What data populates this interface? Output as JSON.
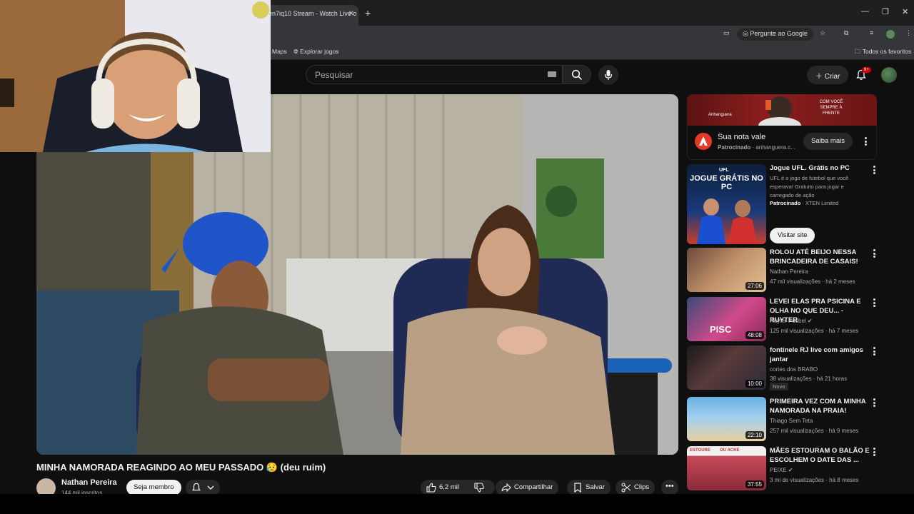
{
  "browser": {
    "tab_title": "en7iq10 Stream - Watch Live o",
    "address_pill": "Pergunte ao Google",
    "bookmarks": [
      "Maps",
      "Explorar jogos"
    ],
    "all_bookmarks": "Todos os favoritos"
  },
  "youtube": {
    "search_placeholder": "Pesquisar",
    "create_label": "Criar",
    "notif_badge": "9+"
  },
  "video": {
    "title": "MINHA NAMORADA REAGINDO AO MEU PASSADO 😥 (deu ruim)",
    "channel": "Nathan Pereira",
    "subscribers": "144 mil inscritos",
    "join_label": "Seja membro",
    "likes": "6,2 mil",
    "share_label": "Compartilhar",
    "save_label": "Salvar",
    "clips_label": "Clips"
  },
  "ad": {
    "title": "Sua nota vale",
    "sponsored": "Patrocinado",
    "advertiser": "anhanguera.c...",
    "cta": "Saiba mais",
    "banner_text": "COM VOCÊ SEMPRE À FRENTE",
    "banner_brand": "Anhanguera"
  },
  "ufl": {
    "title": "Jogue UFL. Grátis no PC",
    "desc": "UFL é o jogo de futebol que você esperava! Gratuito para jogar e carregado de ação",
    "sponsored": "Patrocinado",
    "advertiser": "XTEN Limited",
    "cta": "Visitar site",
    "thumb_brand": "UFL",
    "thumb_text": "JOGUE GRÁTIS NO PC"
  },
  "recommendations": [
    {
      "title": "ROLOU ATÉ BEIJO NESSA BRINCADEIRA DE CASAIS!",
      "channel": "Nathan Pereira",
      "meta": "47 mil visualizações · há 2 meses",
      "duration": "27:06",
      "color": "#8a6a5a"
    },
    {
      "title": "LEVEI ELAS PRA PSICINA E OLHA NO QUE DEU... - RUYTER",
      "channel": "Ruyter Poubel ✔",
      "meta": "125 mil visualizações · há 7 meses",
      "duration": "48:08",
      "color": "#b83a6e"
    },
    {
      "title": "fontinele RJ live com amigos jantar",
      "channel": "cortes dos BRABO",
      "meta": "38 visualizações · há 21 horas",
      "duration": "10:00",
      "color": "#3a3a3a",
      "badge": "Novo"
    },
    {
      "title": "PRIMEIRA VEZ COM A MINHA NAMORADA NA PRAIA!",
      "channel": "Thiago Sem Teta",
      "meta": "257 mil visualizações · há 9 meses",
      "duration": "22:10",
      "color": "#5aa0c8"
    },
    {
      "title": "MÃES ESTOURAM O BALÃO E ESCOLHEM O DATE DAS ...",
      "channel": "PEIXE ✔",
      "meta": "3 mi de visualizações · há 8 meses",
      "duration": "37:55",
      "color": "#c84a5a"
    }
  ],
  "thumb_texts": {
    "estoure": "ESTOURE",
    "ou_ache": "OU ACHE",
    "pisc": "PISC"
  }
}
